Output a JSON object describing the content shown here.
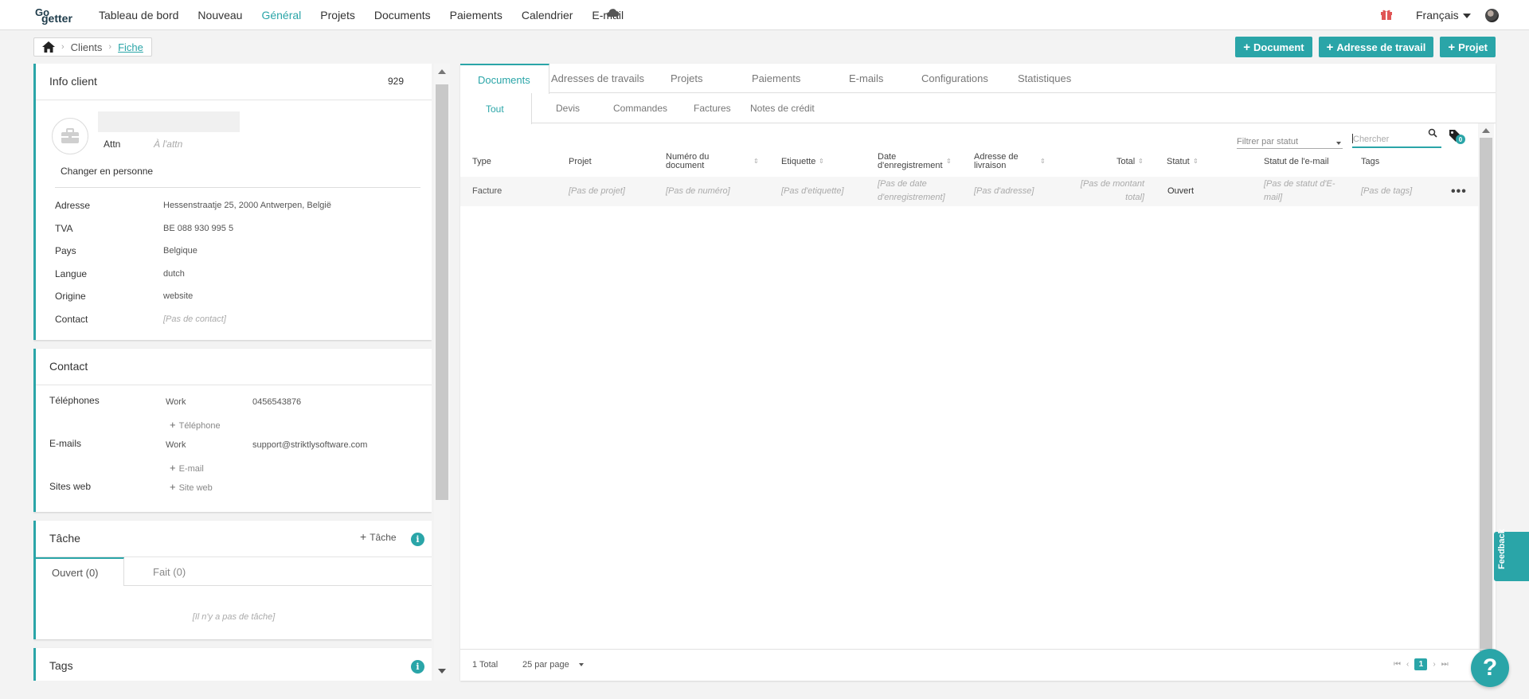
{
  "logo": {
    "line1": "Go",
    "line2": "getter"
  },
  "nav": {
    "items": [
      "Tableau de bord",
      "Nouveau",
      "Général",
      "Projets",
      "Documents",
      "Paiements",
      "Calendrier",
      "E-mail"
    ],
    "active": "Général",
    "language": "Français"
  },
  "breadcrumb": {
    "clients": "Clients",
    "current": "Fiche"
  },
  "actions": {
    "document": "Document",
    "work_address": "Adresse de travail",
    "project": "Projet"
  },
  "client_info": {
    "title": "Info client",
    "number": "929",
    "attn_label": "Attn",
    "attn_placeholder": "À l'attn",
    "change_person": "Changer en personne",
    "fields": [
      {
        "label": "Adresse",
        "value": "Hessenstraatje 25, 2000 Antwerpen, België"
      },
      {
        "label": "TVA",
        "value": "BE 088 930 995 5"
      },
      {
        "label": "Pays",
        "value": "Belgique"
      },
      {
        "label": "Langue",
        "value": "dutch"
      },
      {
        "label": "Origine",
        "value": "website"
      },
      {
        "label": "Contact",
        "value": "[Pas de contact]"
      }
    ]
  },
  "contact": {
    "title": "Contact",
    "phones_label": "Téléphones",
    "phone_type": "Work",
    "phone_value": "0456543876",
    "add_phone": "Téléphone",
    "emails_label": "E-mails",
    "email_type": "Work",
    "email_value": "support@striktlysoftware.com",
    "add_email": "E-mail",
    "sites_label": "Sites web",
    "add_site": "Site web"
  },
  "task": {
    "title": "Tâche",
    "add": "Tâche",
    "tab_open": "Ouvert (0)",
    "tab_done": "Fait (0)",
    "empty": "[Il n'y a pas de tâche]"
  },
  "tags_card": {
    "title": "Tags"
  },
  "main_tabs": [
    "Documents",
    "Adresses de travails",
    "Projets",
    "Paiements",
    "E-mails",
    "Configurations",
    "Statistiques"
  ],
  "sub_tabs": [
    "Tout",
    "Devis",
    "Commandes",
    "Factures",
    "Notes de crédit"
  ],
  "filter": {
    "placeholder": "Filtrer par statut"
  },
  "search": {
    "placeholder": "Chercher"
  },
  "tag_count": "0",
  "table": {
    "headers": {
      "type": "Type",
      "project": "Projet",
      "number": "Numéro du document",
      "label": "Etiquette",
      "date": "Date d'enregistrement",
      "address": "Adresse de livraison",
      "total": "Total",
      "status": "Statut",
      "email_status": "Statut de l'e-mail",
      "tags": "Tags"
    },
    "row": {
      "type": "Facture",
      "project": "[Pas de projet]",
      "number": "[Pas de numéro]",
      "label": "[Pas d'etiquette]",
      "date": "[Pas de date d'enregistrement]",
      "address": "[Pas d'adresse]",
      "total": "[Pas de montant total]",
      "status": "Ouvert",
      "email_status": "[Pas de statut d'E-mail]",
      "tags": "[Pas de tags]"
    }
  },
  "footer": {
    "total": "1 Total",
    "per_page": "25 par page",
    "page": "1"
  },
  "feedback": "Feedback",
  "help": "?"
}
